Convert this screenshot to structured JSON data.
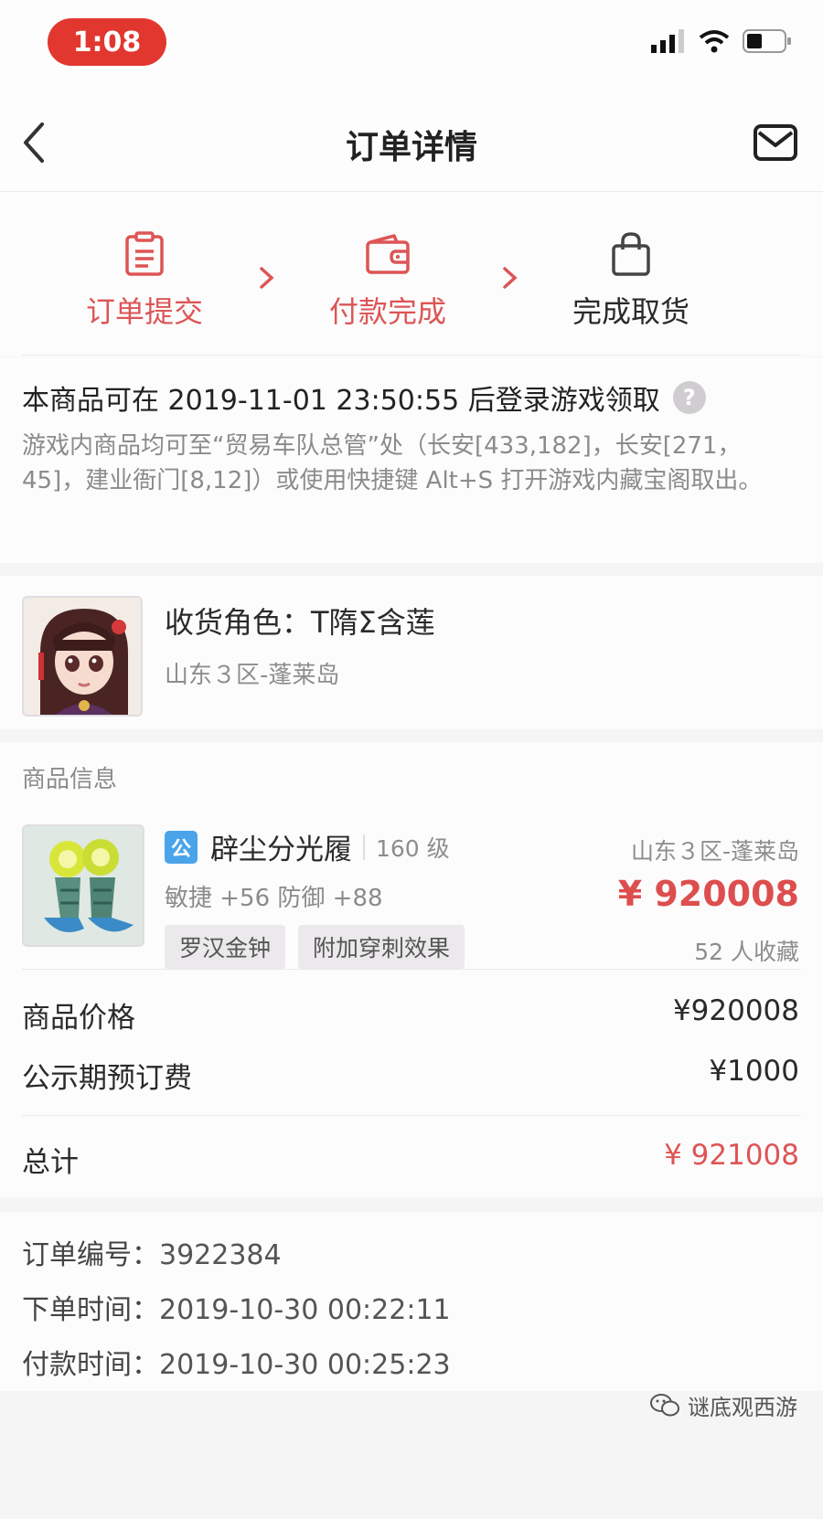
{
  "status_bar": {
    "time": "1:08"
  },
  "nav": {
    "title": "订单详情"
  },
  "steps": [
    {
      "label": "订单提交"
    },
    {
      "label": "付款完成"
    },
    {
      "label": "完成取货"
    }
  ],
  "notice": {
    "title": "本商品可在 2019-11-01 23:50:55 后登录游戏领取",
    "help": "?",
    "body": "游戏内商品均可至“贸易车队总管”处（长安[433,182]，长安[271，45]，建业衙门[8,12]）或使用快捷键 Alt+S 打开游戏内藏宝阁取出。"
  },
  "role": {
    "name": "收货角色：T隋Σ含莲",
    "server": "山东３区-蓬莱岛"
  },
  "goods": {
    "header": "商品信息",
    "badge": "公",
    "name": "辟尘分光履",
    "level": "160 级",
    "server": "山东３区-蓬莱岛",
    "stats": "敏捷 +56 防御 +88",
    "price": "¥ 920008",
    "tags": [
      "罗汉金钟",
      "附加穿刺效果"
    ],
    "favorites": "52 人收藏"
  },
  "prices": {
    "goods_label": "商品价格",
    "goods_value": "¥920008",
    "deposit_label": "公示期预订费",
    "deposit_value": "¥1000",
    "total_label": "总计",
    "total_value": "¥ 921008"
  },
  "order": {
    "number_label": "订单编号：",
    "number_value": "3922384",
    "created_label": "下单时间：",
    "created_value": "2019-10-30 00:22:11",
    "paid_label": "付款时间：",
    "paid_value": "2019-10-30 00:25:23"
  },
  "watermark": "谜底观西游",
  "colors": {
    "accent_red": "#dd5555",
    "price_red": "#dd4e4e",
    "status_pill": "#e2372f",
    "badge_blue": "#4aa4ea"
  }
}
